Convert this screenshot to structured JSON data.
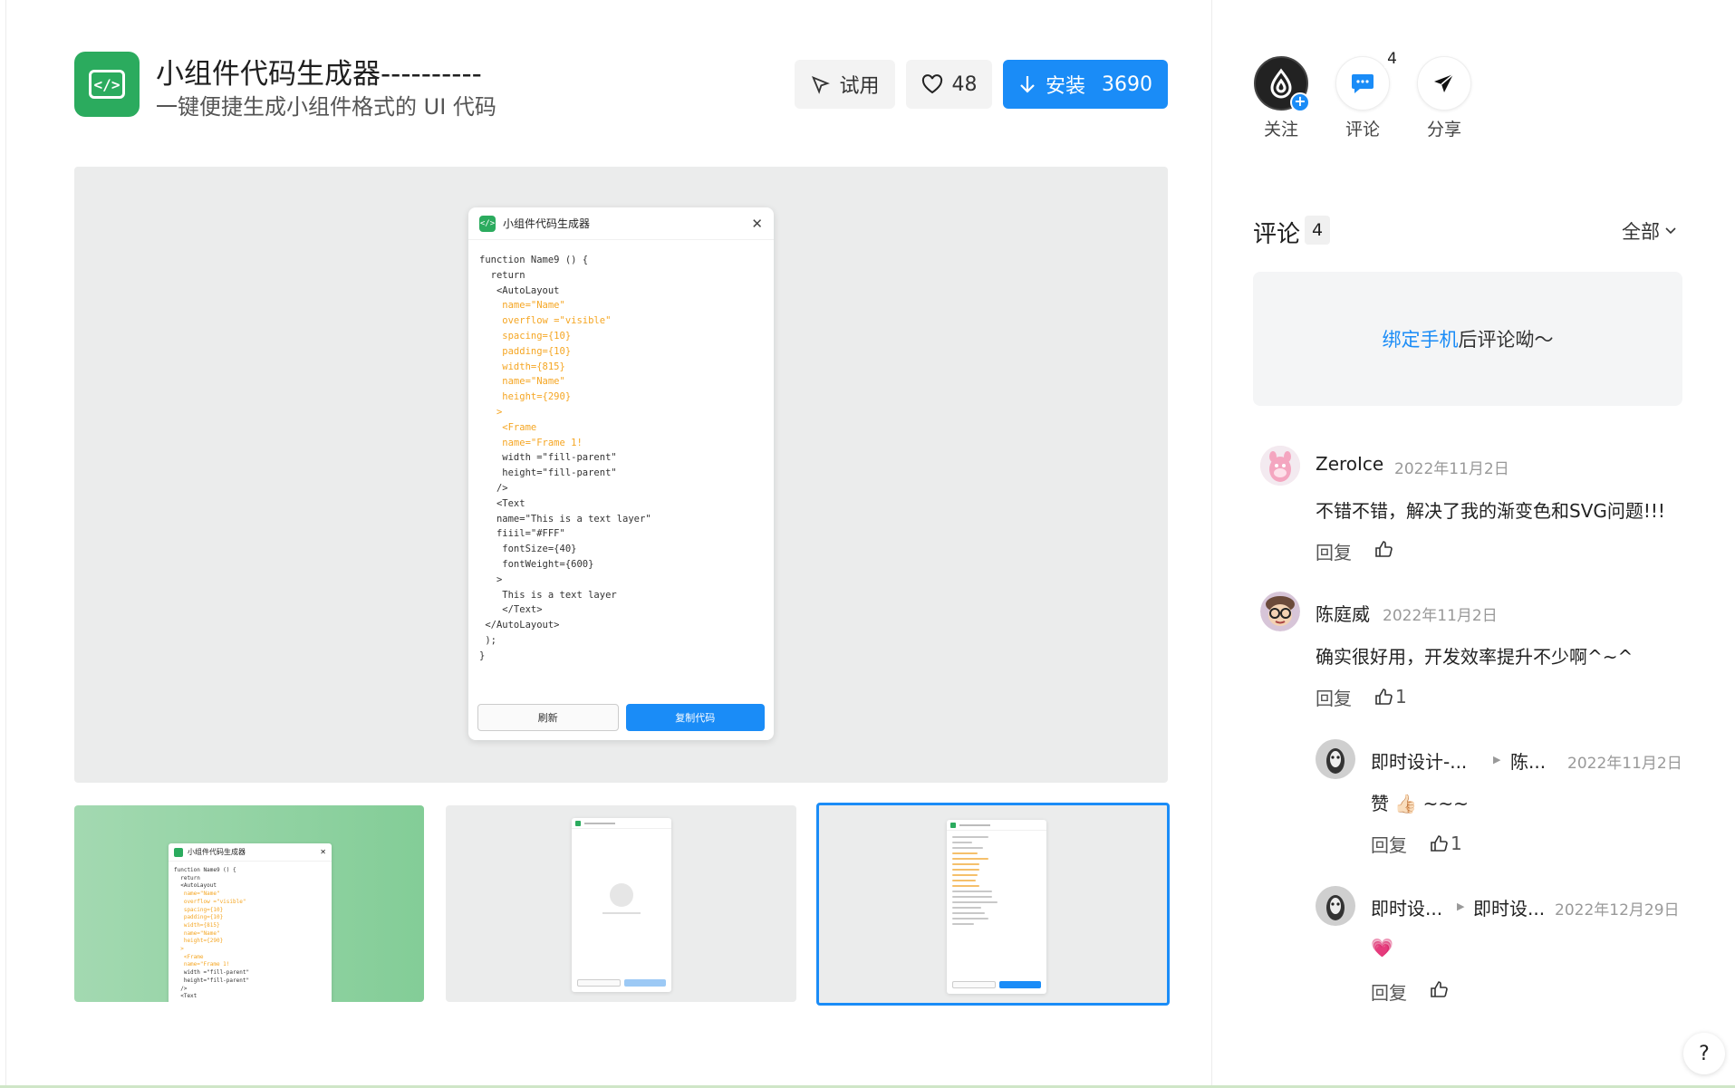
{
  "plugin": {
    "icon": "code-brackets-icon",
    "title": "小组件代码生成器----------",
    "subtitle": "一键便捷生成小组件格式的 UI 代码"
  },
  "actions": {
    "try_label": "试用",
    "like_count": "48",
    "install_label": "安装",
    "install_count": "3690"
  },
  "preview": {
    "mock_title": "小组件代码生成器",
    "code_lines": [
      {
        "t": "function Name9 () {",
        "c": ""
      },
      {
        "t": "  return",
        "c": ""
      },
      {
        "t": "   <AutoLayout",
        "c": ""
      },
      {
        "t": "    name=\"Name\"",
        "c": "o"
      },
      {
        "t": "    overflow =\"visible\"",
        "c": "o"
      },
      {
        "t": "    spacing={10}",
        "c": "o"
      },
      {
        "t": "    padding={10}",
        "c": "o"
      },
      {
        "t": "    width={815}",
        "c": "o"
      },
      {
        "t": "    name=\"Name\"",
        "c": "o"
      },
      {
        "t": "    height={290}",
        "c": "o"
      },
      {
        "t": "   >",
        "c": "o"
      },
      {
        "t": "    <Frame",
        "c": "o"
      },
      {
        "t": "    name=\"Frame 1!",
        "c": "o"
      },
      {
        "t": "    width =\"fill-parent\"",
        "c": ""
      },
      {
        "t": "    height=\"fill-parent\"",
        "c": ""
      },
      {
        "t": "   />",
        "c": ""
      },
      {
        "t": "   <Text",
        "c": ""
      },
      {
        "t": "   name=\"This is a text layer\"",
        "c": ""
      },
      {
        "t": "   fiiil=\"#FFF\"",
        "c": ""
      },
      {
        "t": "    fontSize={40}",
        "c": ""
      },
      {
        "t": "    fontWeight={600}",
        "c": ""
      },
      {
        "t": "   >",
        "c": ""
      },
      {
        "t": "    This is a text layer",
        "c": ""
      },
      {
        "t": "    </Text>",
        "c": ""
      },
      {
        "t": " </AutoLayout>",
        "c": ""
      },
      {
        "t": " );",
        "c": ""
      },
      {
        "t": "}",
        "c": ""
      }
    ],
    "refresh_label": "刷新",
    "copy_label": "复制代码"
  },
  "thumb1": {
    "mock_title": "小组件代码生成器",
    "code_lines": [
      {
        "t": "function Name9 () {",
        "c": ""
      },
      {
        "t": "  return",
        "c": ""
      },
      {
        "t": "  <AutoLayout",
        "c": ""
      },
      {
        "t": "   name=\"Name\"",
        "c": "o"
      },
      {
        "t": "   overflow =\"visible\"",
        "c": "o"
      },
      {
        "t": "   spacing={10}",
        "c": "o"
      },
      {
        "t": "   padding={10}",
        "c": "o"
      },
      {
        "t": "   width={815}",
        "c": "o"
      },
      {
        "t": "   name=\"Name\"",
        "c": "o"
      },
      {
        "t": "   height={290}",
        "c": "o"
      },
      {
        "t": "  >",
        "c": "o"
      },
      {
        "t": "   <Frame",
        "c": "o"
      },
      {
        "t": "   name=\"Frame 1!",
        "c": "o"
      },
      {
        "t": "   width =\"fill-parent\"",
        "c": ""
      },
      {
        "t": "   height=\"fill-parent\"",
        "c": ""
      },
      {
        "t": "  />",
        "c": ""
      },
      {
        "t": "  <Text",
        "c": ""
      }
    ]
  },
  "social": {
    "follow_label": "关注",
    "comment_label": "评论",
    "comment_badge": "4",
    "share_label": "分享"
  },
  "comments": {
    "title": "评论",
    "count": "4",
    "filter_label": "全部",
    "bind_link": "绑定手机",
    "bind_suffix": " 后评论呦～",
    "reply_label": "回复",
    "items": [
      {
        "user": "ZeroIce",
        "date": "2022年11月2日",
        "text": "不错不错，解决了我的渐变色和SVG问题!!!",
        "likes": ""
      },
      {
        "user": "陈庭威",
        "date": "2022年11月2日",
        "text": "确实很好用，开发效率提升不少啊^~^",
        "likes": "1"
      }
    ],
    "replies": [
      {
        "user": "即时设计-...",
        "to": "陈...",
        "date": "2022年11月2日",
        "text": "赞 👍🏻 ~~~",
        "likes": "1"
      },
      {
        "user": "即时设...",
        "to": "即时设...",
        "date": "2022年12月29日",
        "text": "💗",
        "likes": ""
      }
    ]
  },
  "help_label": "?"
}
